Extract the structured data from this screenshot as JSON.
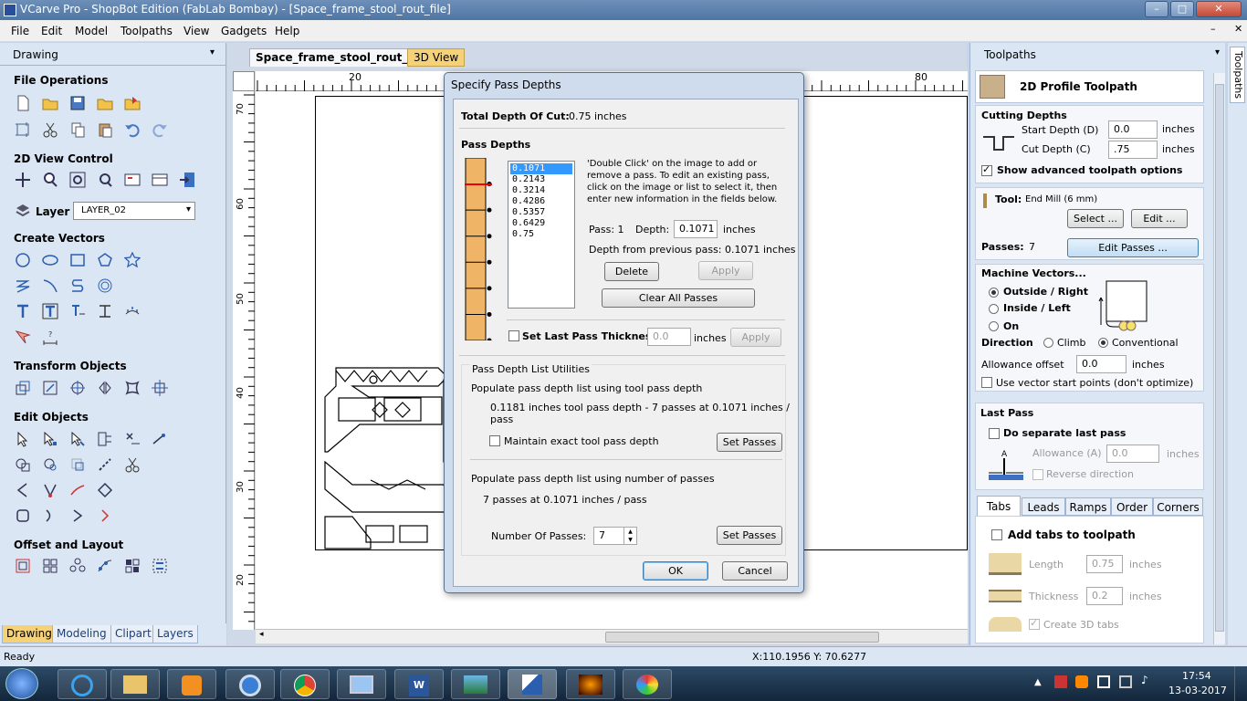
{
  "window": {
    "title": "VCarve Pro - ShopBot Edition (FabLab Bombay) - [Space_frame_stool_rout_file]"
  },
  "menu": [
    "File",
    "Edit",
    "Model",
    "Toolpaths",
    "View",
    "Gadgets",
    "Help"
  ],
  "left": {
    "title": "Drawing",
    "pin": "📌",
    "file_ops": "File Operations",
    "view_control": "2D View Control",
    "layer_label": "Layer",
    "layer_value": "LAYER_02",
    "create_vectors": "Create Vectors",
    "transform": "Transform Objects",
    "edit_objects": "Edit Objects",
    "offset_layout": "Offset and Layout",
    "tabs": [
      "Drawing",
      "Modeling",
      "Clipart",
      "Layers"
    ]
  },
  "doc": {
    "tabs": [
      "Space_frame_stool_rout_file",
      "3D View"
    ],
    "ruler_top": [
      "20",
      "80"
    ],
    "ruler_left": [
      "70",
      "60",
      "50",
      "40",
      "30",
      "20"
    ]
  },
  "right": {
    "title": "Toolpaths",
    "side_tab": "Toolpaths",
    "toolpath_name": "2D Profile Toolpath",
    "cutting_depths": "Cutting Depths",
    "start_depth_label": "Start Depth (D)",
    "start_depth": "0.0",
    "cut_depth_label": "Cut Depth (C)",
    "cut_depth": ".75",
    "unit": "inches",
    "show_advanced": "Show advanced toolpath options",
    "tool_label": "Tool:",
    "tool_value": "End Mill (6 mm)",
    "select_btn": "Select ...",
    "edit_btn": "Edit ...",
    "passes_label": "Passes:",
    "passes_value": "7",
    "edit_passes_btn": "Edit Passes ...",
    "machine_vectors": "Machine Vectors...",
    "outside_right": "Outside / Right",
    "inside_left": "Inside / Left",
    "on": "On",
    "direction": "Direction",
    "climb": "Climb",
    "conventional": "Conventional",
    "allowance_offset": "Allowance offset",
    "allowance_value": "0.0",
    "use_vector_start": "Use vector start points (don't optimize)",
    "last_pass": "Last Pass",
    "do_separate": "Do separate last pass",
    "allowance_a": "Allowance (A)",
    "allowance_a_value": "0.0",
    "reverse_direction": "Reverse direction",
    "bottom_tabs": [
      "Tabs",
      "Leads",
      "Ramps",
      "Order",
      "Corners"
    ],
    "add_tabs": "Add tabs to toolpath",
    "length_label": "Length",
    "length_value": "0.75",
    "thickness_label": "Thickness",
    "thickness_value": "0.2",
    "create_3d_tabs": "Create 3D tabs"
  },
  "dialog": {
    "title": "Specify Pass Depths",
    "total_depth_label": "Total Depth Of Cut:",
    "total_depth_value": "0.75 inches",
    "pass_depths_heading": "Pass Depths",
    "pass_list": [
      "0.1071",
      "0.2143",
      "0.3214",
      "0.4286",
      "0.5357",
      "0.6429",
      "0.75"
    ],
    "instructions": "'Double Click' on the image to add or remove a pass. To edit an existing pass, click on the image or list to select it, then enter new information in the fields below.",
    "pass_label": "Pass: 1",
    "depth_label": "Depth:",
    "depth_value": "0.1071",
    "inches": "inches",
    "depth_prev": "Depth from previous pass:  0.1071 inches",
    "delete_btn": "Delete",
    "apply_btn": "Apply",
    "clear_all_btn": "Clear All Passes",
    "set_last_pass": "Set Last Pass Thickness",
    "last_pass_value": "0.0",
    "utilities_heading": "Pass Depth List Utilities",
    "populate_tool": "Populate pass depth list using tool pass depth",
    "tool_summary": "0.1181 inches tool pass depth - 7 passes at 0.1071 inches / pass",
    "maintain_exact": "Maintain exact tool pass depth",
    "set_passes_btn": "Set Passes",
    "populate_number": "Populate pass depth list using number of passes",
    "number_summary": "7 passes at 0.1071 inches / pass",
    "num_passes_label": "Number Of Passes:",
    "num_passes_value": "7",
    "ok_btn": "OK",
    "cancel_btn": "Cancel"
  },
  "status": {
    "left": "Ready",
    "coords": "X:110.1956 Y: 70.6277"
  },
  "taskbar": {
    "time": "17:54",
    "date": "13-03-2017"
  }
}
